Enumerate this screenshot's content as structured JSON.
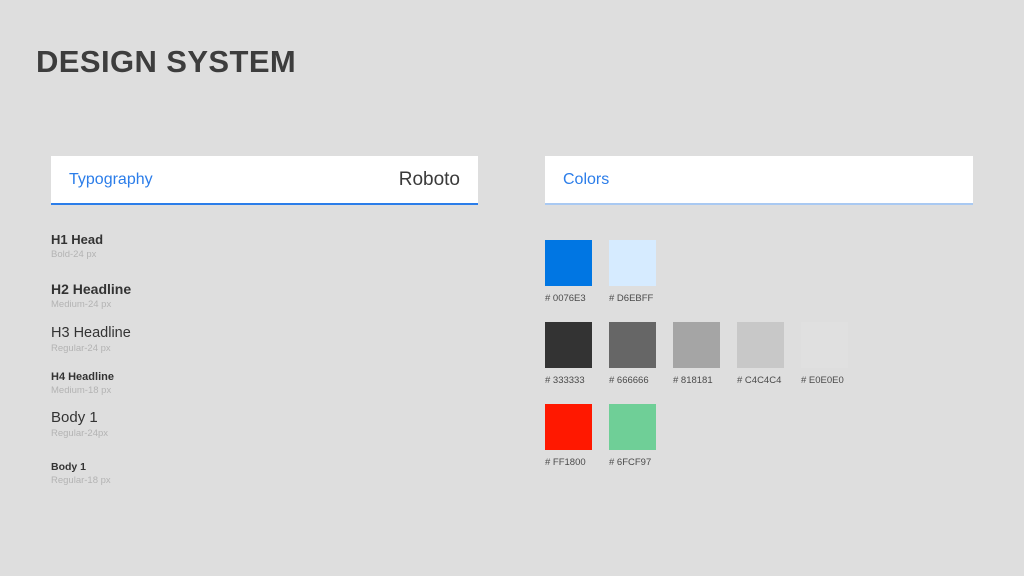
{
  "page": {
    "title": "DESIGN SYSTEM",
    "background_color": "#DEDEDE"
  },
  "typography_card": {
    "label": "Typography",
    "value": "Roboto",
    "accent_color": "#2B7DE9",
    "items": [
      {
        "sample": "H1 Head",
        "spec": "Bold-24 px"
      },
      {
        "sample": "H2 Headline",
        "spec": "Medium-24 px"
      },
      {
        "sample": "H3 Headline",
        "spec": "Regular-24 px"
      },
      {
        "sample": "H4 Headline",
        "spec": "Medium-18 px"
      },
      {
        "sample": "Body 1",
        "spec": "Regular-24px"
      },
      {
        "sample": "Body 1",
        "spec": "Regular-18 px"
      }
    ]
  },
  "colors_card": {
    "label": "Colors",
    "accent_color": "#A9C9F2",
    "rows": [
      [
        {
          "hex_label": "# 0076E3",
          "color": "#0076E3"
        },
        {
          "hex_label": "# D6EBFF",
          "color": "#D6EBFF"
        }
      ],
      [
        {
          "hex_label": "# 333333",
          "color": "#333333"
        },
        {
          "hex_label": "# 666666",
          "color": "#666666"
        },
        {
          "hex_label": "# 818181",
          "color": "#A5A5A5"
        },
        {
          "hex_label": "# C4C4C4",
          "color": "#C8C8C8"
        },
        {
          "hex_label": "# E0E0E0",
          "color": "#E0E0E0"
        }
      ],
      [
        {
          "hex_label": "# FF1800",
          "color": "#FF1800"
        },
        {
          "hex_label": "# 6FCF97",
          "color": "#6FCF97"
        }
      ]
    ]
  }
}
